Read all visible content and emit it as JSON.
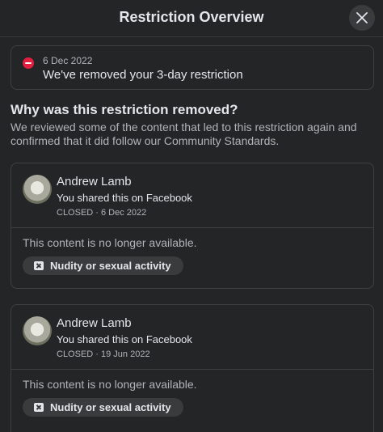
{
  "header": {
    "title": "Restriction Overview",
    "close_icon": "close-icon"
  },
  "status": {
    "icon": "minus-circle-icon",
    "date": "6 Dec 2022",
    "message": "We've removed your 3-day restriction"
  },
  "reason": {
    "heading": "Why was this restriction removed?",
    "body": "We reviewed some of the content that led to this restriction again and confirmed that it did follow our Community Standards."
  },
  "posts": [
    {
      "author": "Andrew Lamb",
      "shared": "You shared this on Facebook",
      "meta": "CLOSED · 6 Dec 2022",
      "unavailable": "This content is no longer available.",
      "tag": "Nudity or sexual activity"
    },
    {
      "author": "Andrew Lamb",
      "shared": "You shared this on Facebook",
      "meta": "CLOSED · 19 Jun 2022",
      "unavailable": "This content is no longer available.",
      "tag": "Nudity or sexual activity"
    }
  ]
}
